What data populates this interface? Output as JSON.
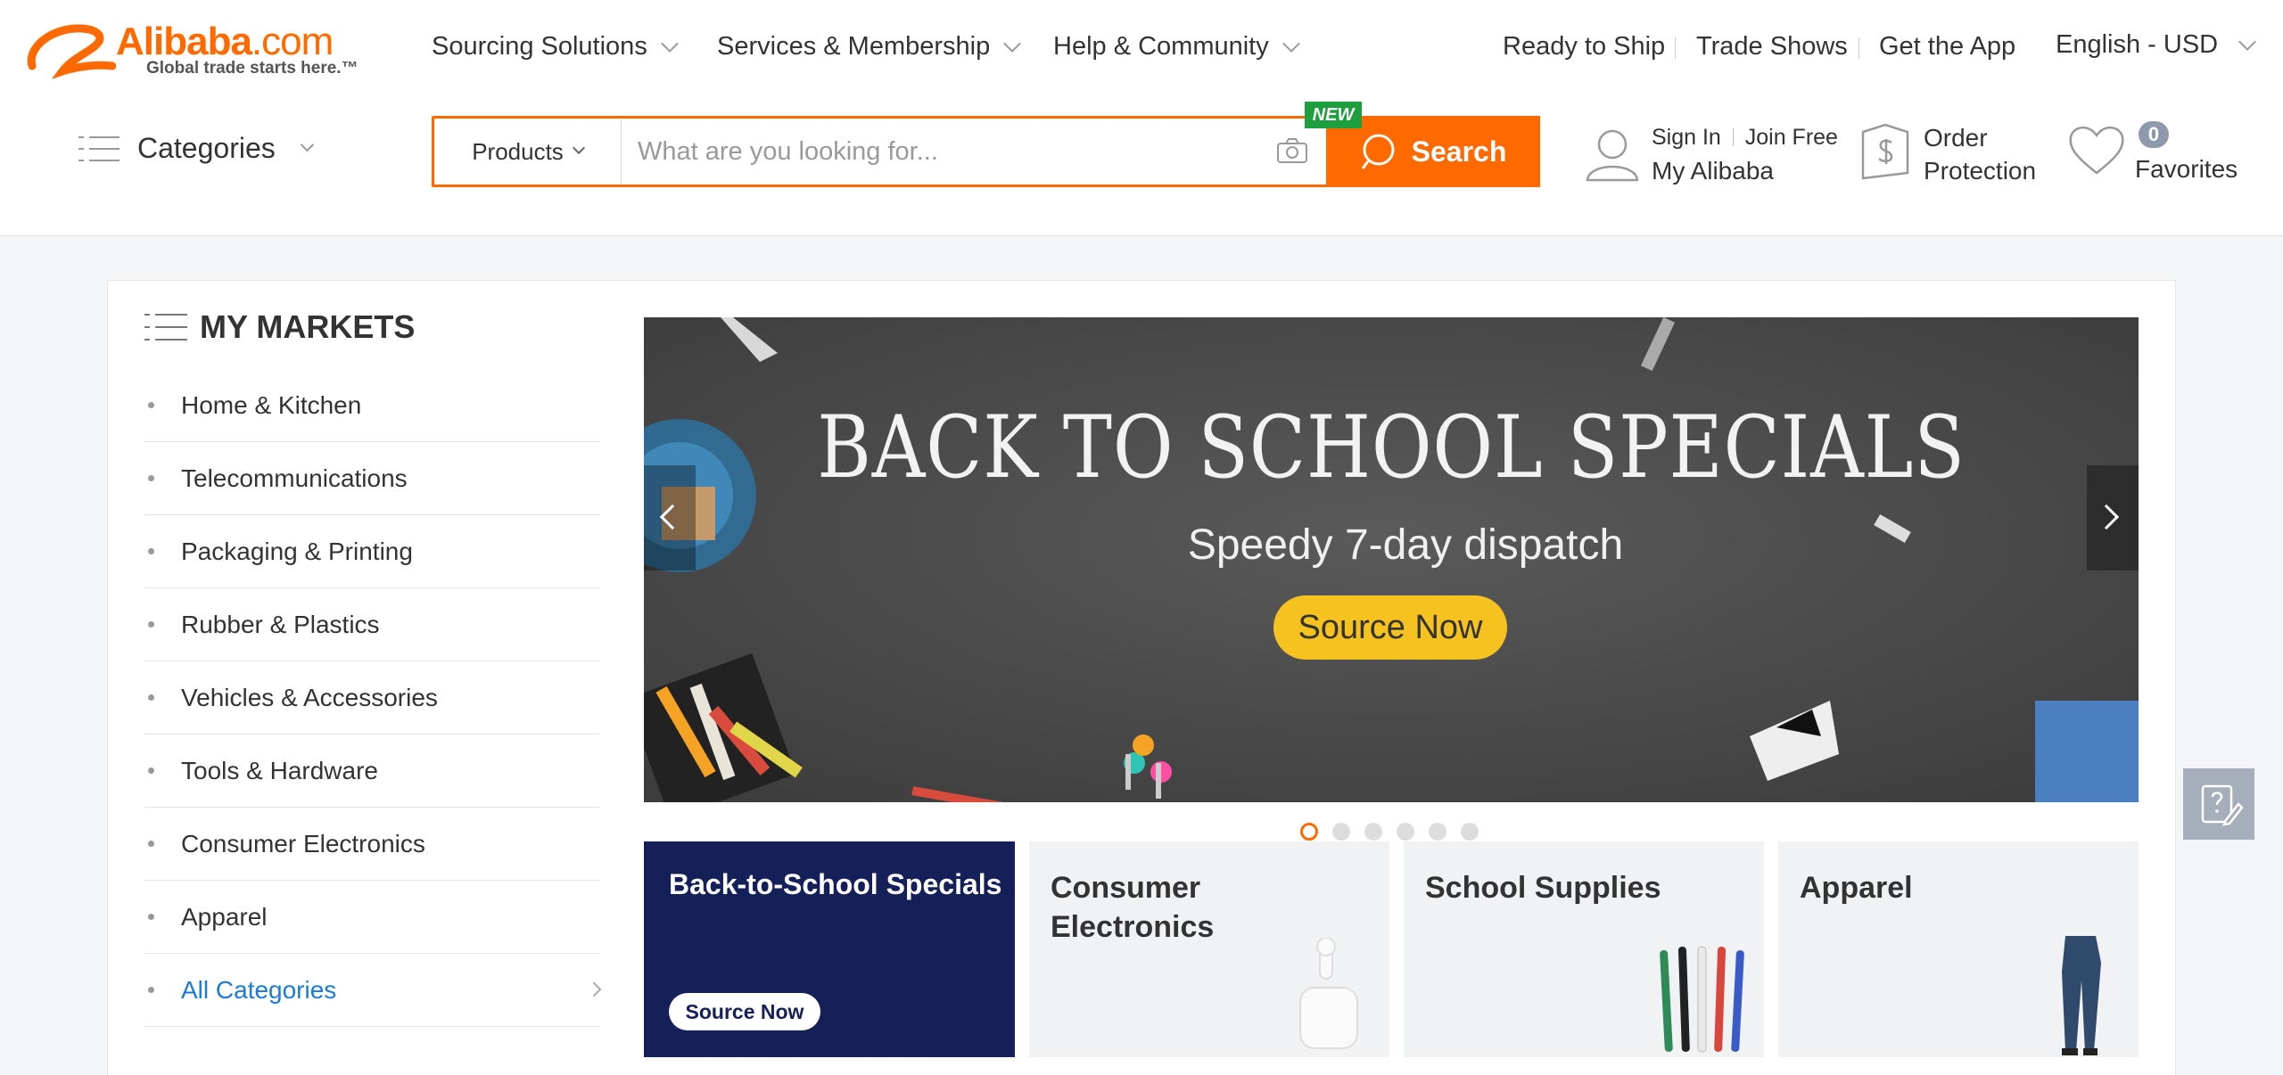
{
  "logo": {
    "brand": "Alibaba",
    "suffix": ".com",
    "tagline": "Global trade starts here.™"
  },
  "topnav": {
    "sourcing": "Sourcing Solutions",
    "services": "Services & Membership",
    "help": "Help & Community",
    "ready_to_ship": "Ready to Ship",
    "trade_shows": "Trade Shows",
    "get_app": "Get the App",
    "language": "English - USD"
  },
  "categories_label": "Categories",
  "search": {
    "type": "Products",
    "placeholder": "What are you looking for...",
    "button": "Search",
    "new_badge": "NEW"
  },
  "account": {
    "sign_in": "Sign In",
    "join": "Join Free",
    "my_alibaba": "My Alibaba"
  },
  "order_protection": {
    "line1": "Order",
    "line2": "Protection"
  },
  "favorites": {
    "count": "0",
    "label": "Favorites"
  },
  "markets": {
    "title": "MY MARKETS",
    "items": [
      "Home & Kitchen",
      "Telecommunications",
      "Packaging & Printing",
      "Rubber & Plastics",
      "Vehicles & Accessories",
      "Tools & Hardware",
      "Consumer Electronics",
      "Apparel"
    ],
    "all": "All Categories"
  },
  "banner": {
    "title": "BACK TO SCHOOL SPECIALS",
    "subtitle": "Speedy 7-day dispatch",
    "cta": "Source Now",
    "slide_count": 6,
    "active_slide": 1
  },
  "cards": [
    {
      "title": "Back-to-School Specials",
      "cta": "Source Now"
    },
    {
      "title": "Consumer\nElectronics"
    },
    {
      "title": "School Supplies"
    },
    {
      "title": "Apparel"
    }
  ],
  "colors": {
    "accent": "#ff6a00",
    "link": "#1a7bd8",
    "navy": "#152059",
    "new_green": "#1e9f3f",
    "cta_yellow": "#f6c21f"
  }
}
